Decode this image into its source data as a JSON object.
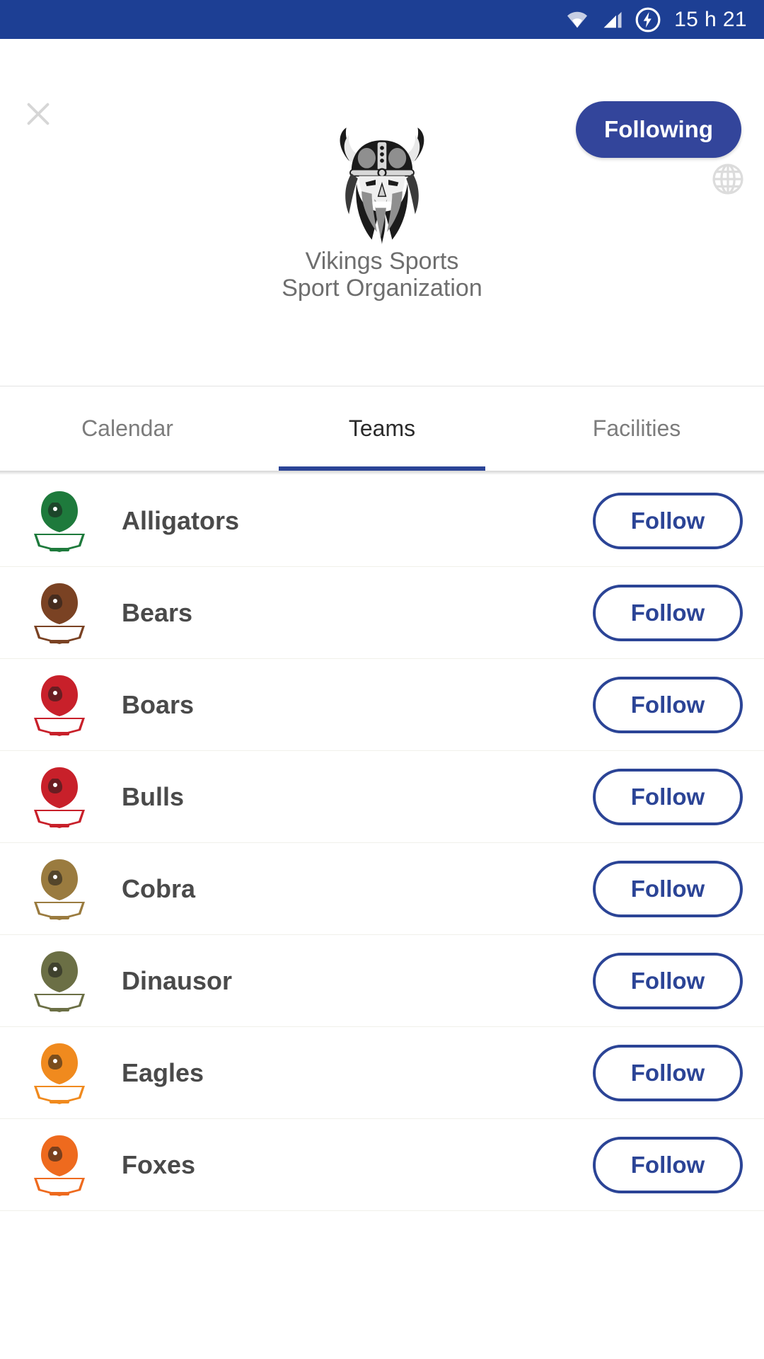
{
  "status_bar": {
    "wifi_icon": "wifi-icon",
    "signal_icon": "cell-signal-icon",
    "battery_icon": "battery-charging-icon",
    "time": "15 h 21",
    "background_color": "#1d3f94"
  },
  "header": {
    "close_icon": "close-icon",
    "globe_icon": "globe-icon",
    "following_label": "Following",
    "following_color": "#33459b",
    "logo_icon": "viking-mascot-logo",
    "org_name": "Vikings Sports",
    "org_type": "Sport Organization"
  },
  "tabs": {
    "active_index": 1,
    "accent_color": "#2b4496",
    "items": [
      {
        "label": "Calendar"
      },
      {
        "label": "Teams"
      },
      {
        "label": "Facilities"
      }
    ]
  },
  "teams": {
    "follow_label": "Follow",
    "accent_color": "#2b4496",
    "items": [
      {
        "name": "Alligators",
        "logo": "alligator-logo",
        "logo_color": "#1e7a3c",
        "follow_label": "Follow"
      },
      {
        "name": "Bears",
        "logo": "bear-logo",
        "logo_color": "#7a4223",
        "follow_label": "Follow"
      },
      {
        "name": "Boars",
        "logo": "boar-logo",
        "logo_color": "#c8202a",
        "follow_label": "Follow"
      },
      {
        "name": "Bulls",
        "logo": "bull-logo",
        "logo_color": "#c8202a",
        "follow_label": "Follow"
      },
      {
        "name": "Cobra",
        "logo": "cobra-logo",
        "logo_color": "#9a7b3f",
        "follow_label": "Follow"
      },
      {
        "name": "Dinausor",
        "logo": "dinosaur-logo",
        "logo_color": "#6b6f45",
        "follow_label": "Follow"
      },
      {
        "name": "Eagles",
        "logo": "eagle-logo",
        "logo_color": "#f08a1e",
        "follow_label": "Follow"
      },
      {
        "name": "Foxes",
        "logo": "fox-logo",
        "logo_color": "#ee6a1e",
        "follow_label": "Follow"
      }
    ]
  }
}
